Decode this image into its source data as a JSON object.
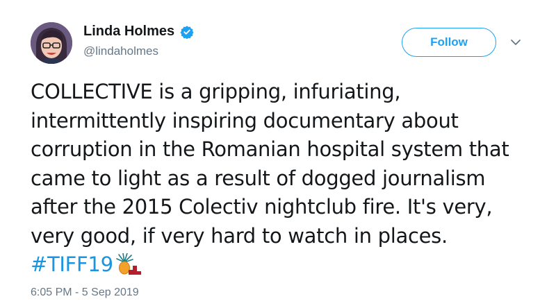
{
  "author": {
    "display_name": "Linda Holmes",
    "handle": "@lindaholmes",
    "verified": true,
    "avatar_icon": "user-avatar-photo"
  },
  "actions": {
    "follow_label": "Follow",
    "more_icon": "chevron-down-icon"
  },
  "tweet": {
    "text": "COLLECTIVE is a gripping, infuriating, intermittently inspiring documentary about corruption in the Romanian hospital system that came to light as a result of dogged journalism after the 2015 Colectiv nightclub fire. It's very, very good, if very hard to watch in places.",
    "hashtag": "#TIFF19",
    "hashflag_icon": "tiff-hashflag-icon",
    "timestamp": "6:05 PM - 5 Sep 2019"
  },
  "colors": {
    "accent": "#1da1f2",
    "hashtag": "#1b95e0",
    "secondary_text": "#657786",
    "primary_text": "#14171a"
  }
}
